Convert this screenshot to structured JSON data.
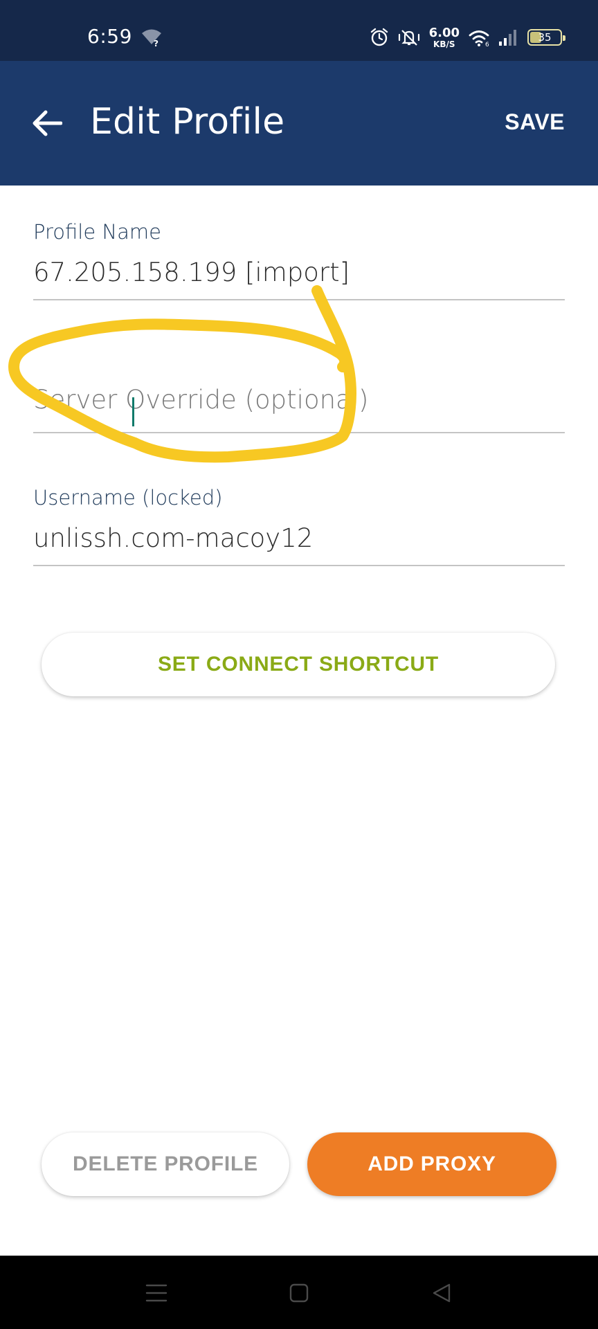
{
  "status_bar": {
    "time": "6:59",
    "net_speed_value": "6.00",
    "net_speed_unit": "KB/S",
    "battery_level": "35"
  },
  "app_bar": {
    "title": "Edit Profile",
    "save_label": "SAVE"
  },
  "form": {
    "profile_name": {
      "label": "Profile Name",
      "value": "67.205.158.199 [import]"
    },
    "server_override": {
      "placeholder": "Server Override (optional)",
      "value": ""
    },
    "username": {
      "label": "Username (locked)",
      "value": "unlissh.com-macoy12"
    }
  },
  "buttons": {
    "set_connect_shortcut": "SET CONNECT SHORTCUT",
    "delete_profile": "DELETE PROFILE",
    "add_proxy": "ADD PROXY"
  },
  "colors": {
    "status_bar_bg": "#15284a",
    "app_bar_bg": "#1c3a6b",
    "accent_green": "#8aaa16",
    "accent_orange": "#ee7d25",
    "annotation_yellow": "#f7c823"
  },
  "icons": {
    "status_left": [
      "wifi-question-icon"
    ],
    "status_right": [
      "alarm-icon",
      "vibrate-icon",
      "wifi-icon",
      "signal-icon",
      "battery-icon"
    ],
    "app_bar": [
      "back-arrow-icon"
    ],
    "nav": [
      "menu-icon",
      "home-icon",
      "back-icon"
    ]
  }
}
